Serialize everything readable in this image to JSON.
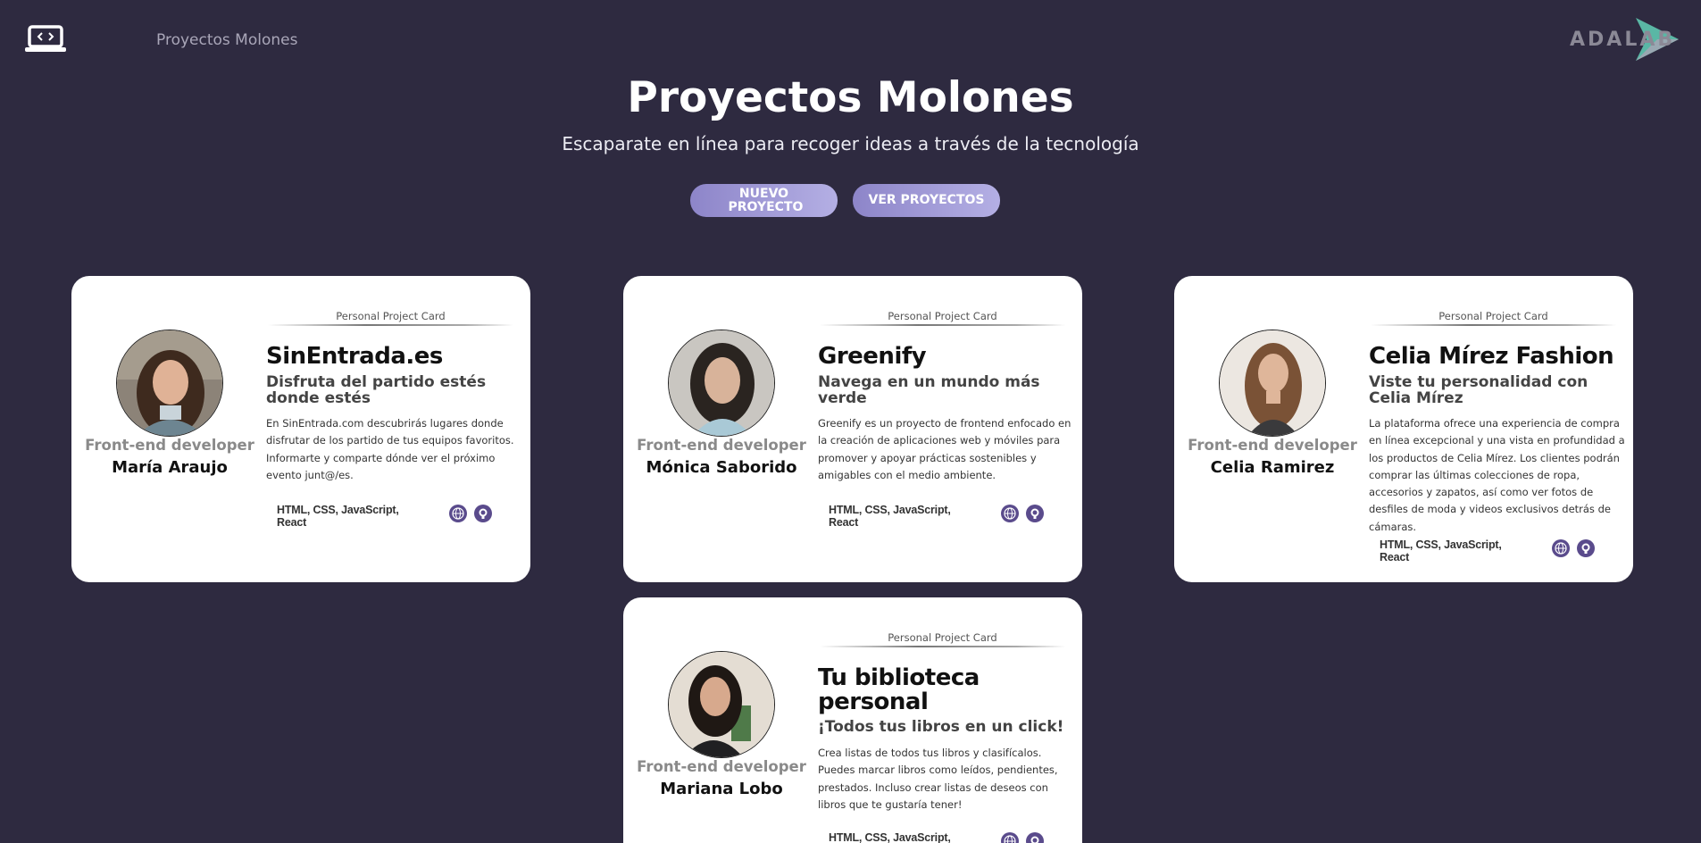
{
  "header": {
    "brand": "Proyectos Molones",
    "logo_icon": "laptop-code-icon",
    "partner_logo": "ADALAB"
  },
  "hero": {
    "title": "Proyectos Molones",
    "subtitle": "Escaparate en línea para recoger ideas a través de la tecnología",
    "new_project_label": "NUEVO PROYECTO",
    "view_projects_label": "VER PROYECTOS"
  },
  "colors": {
    "background": "#2e2a40",
    "button_gradient_start": "#8d85c9",
    "button_gradient_end": "#b4afe4",
    "icon_purple": "#5a4b8c",
    "adalab_teal": "#5fc6b0"
  },
  "cards": [
    {
      "label": "Personal Project Card",
      "role": "Front-end developer",
      "author": "María Araujo",
      "name": "SinEntrada.es",
      "slogan": "Disfruta del partido estés donde estés",
      "desc": "En SinEntrada.com descubrirás lugares donde disfrutar de los partido de tus equipos favoritos. Informarte y comparte dónde ver el próximo evento junt@/es.",
      "technologies": "HTML, CSS, JavaScript, React"
    },
    {
      "label": "Personal Project Card",
      "role": "Front-end developer",
      "author": "Mónica Saborido",
      "name": "Greenify",
      "slogan": "Navega en un mundo más verde",
      "desc": "Greenify es un proyecto de frontend enfocado en la creación de aplicaciones web y móviles para promover y apoyar prácticas sostenibles y amigables con el medio ambiente.",
      "technologies": "HTML, CSS, JavaScript, React"
    },
    {
      "label": "Personal Project Card",
      "role": "Front-end developer",
      "author": "Celia Ramirez",
      "name": "Celia Mírez Fashion",
      "slogan": "Viste tu personalidad con Celia Mírez",
      "desc": "La plataforma ofrece una experiencia de compra en línea excepcional y una vista en profundidad a los productos de Celia Mírez. Los clientes podrán comprar las últimas colecciones de ropa, accesorios y zapatos, así como ver fotos de desfiles de moda y videos exclusivos detrás de cámaras.",
      "technologies": "HTML, CSS, JavaScript, React"
    },
    {
      "label": "Personal Project Card",
      "role": "Front-end developer",
      "author": "Mariana Lobo",
      "name": "Tu biblioteca personal",
      "slogan": "¡Todos tus libros en un click!",
      "desc": "Crea listas de todos tus libros y clasifícalos. Puedes marcar libros como leídos, pendientes, prestados. Incluso crear listas de deseos con libros que te gustaría tener!",
      "technologies": "HTML, CSS, JavaScript, React"
    }
  ]
}
